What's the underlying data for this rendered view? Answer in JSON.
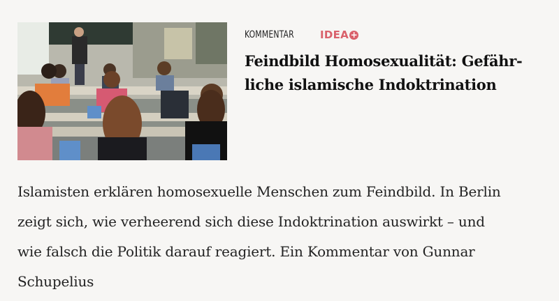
{
  "article": {
    "kicker": "Kommentar",
    "source_badge": "IDEA",
    "source_badge_icon": "plus-icon",
    "headline_lines": [
      "Feindbild Homosexualität: Gefähr-",
      "liche islamische Indoktrination"
    ],
    "teaser_lines": [
      "Islamisten erklären homosexuelle Menschen zum Feindbild. In Berlin",
      "zeigt sich, wie verheerend sich diese Indoktrination auswirkt – und",
      "wie falsch die Politik darauf reagiert. Ein Kommentar von Gunnar",
      "Schupelius"
    ],
    "image_alt": "classroom-photo"
  },
  "colors": {
    "background": "#f7f6f4",
    "badge": "#d9616b",
    "text": "#1a1a1a"
  }
}
